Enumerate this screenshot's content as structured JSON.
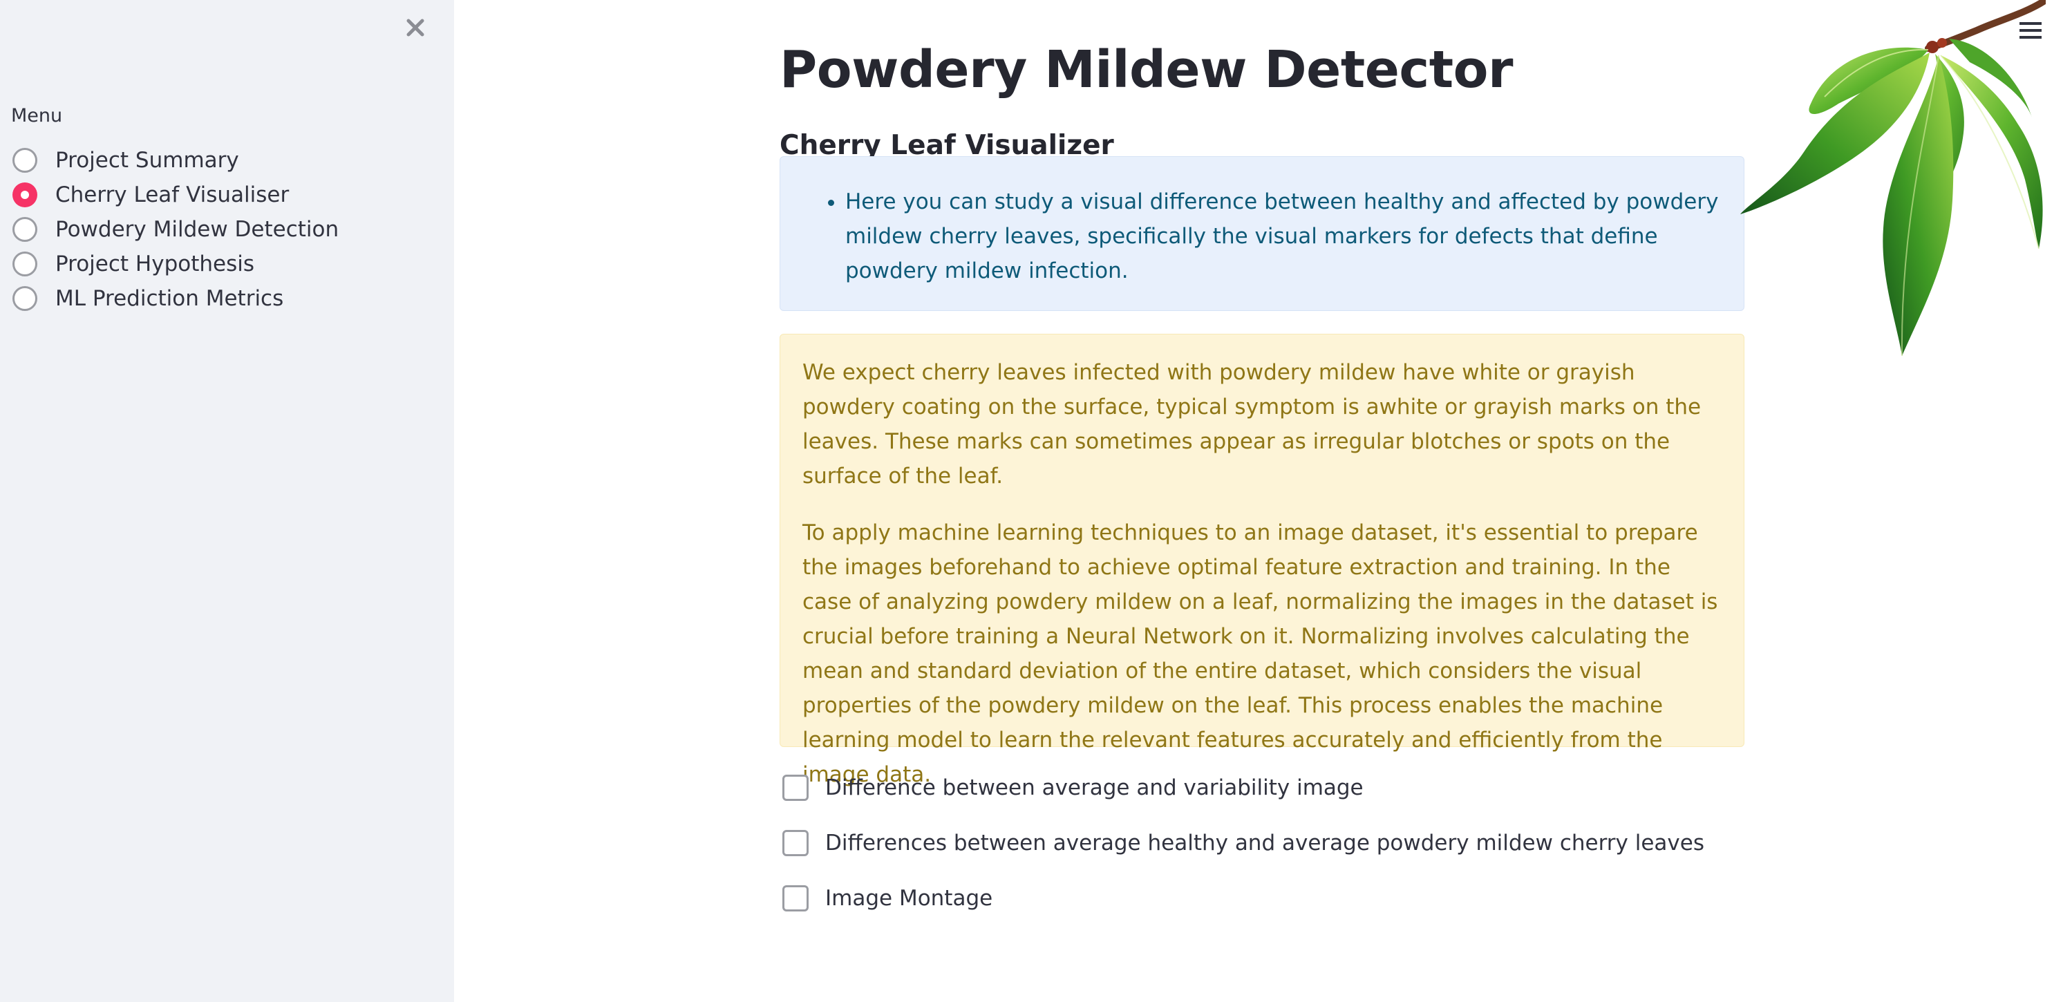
{
  "sidebar": {
    "close_icon": "close-icon",
    "menu_label": "Menu",
    "items": [
      {
        "label": "Project Summary",
        "selected": false
      },
      {
        "label": "Cherry Leaf Visualiser",
        "selected": true
      },
      {
        "label": "Powdery Mildew Detection",
        "selected": false
      },
      {
        "label": "Project Hypothesis",
        "selected": false
      },
      {
        "label": "ML Prediction Metrics",
        "selected": false
      }
    ]
  },
  "main": {
    "title": "Powdery Mildew Detector",
    "subheader": "Cherry Leaf Visualizer",
    "info_bullet": "Here you can study a visual difference between healthy and affected by powdery mildew cherry leaves, specifically the visual markers for defects that define powdery mildew infection.",
    "warning_paragraphs": [
      "We expect cherry leaves infected with powdery mildew have white or grayish powdery coating on the surface, typical symptom is awhite or grayish marks on the leaves. These marks can sometimes appear as irregular blotches or spots on the surface of the leaf.",
      "To apply machine learning techniques to an image dataset, it's essential to prepare the images beforehand to achieve optimal feature extraction and training. In the case of analyzing powdery mildew on a leaf, normalizing the images in the dataset is crucial before training a Neural Network on it. Normalizing involves calculating the mean and standard deviation of the entire dataset, which considers the visual properties of the powdery mildew on the leaf. This process enables the machine learning model to learn the relevant features accurately and efficiently from the image data."
    ],
    "checkboxes": [
      {
        "label": "Difference between average and variability image",
        "checked": false
      },
      {
        "label": "Differences between average healthy and average powdery mildew cherry leaves",
        "checked": false
      },
      {
        "label": "Image Montage",
        "checked": false
      }
    ]
  },
  "header": {
    "menu_icon": "hamburger-menu-icon",
    "decoration": "cherry-leaves-image"
  },
  "colors": {
    "sidebar_bg": "#f0f2f6",
    "accent": "#f63366",
    "info_bg": "#e8f0fc",
    "info_text": "#0e5a78",
    "warning_bg": "#fdf4d7",
    "warning_text": "#8f7616"
  }
}
